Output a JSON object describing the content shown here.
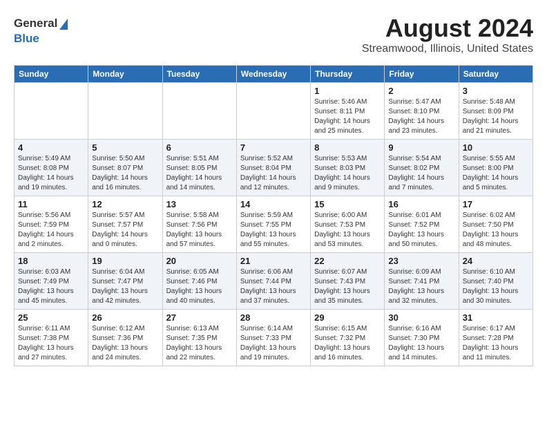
{
  "logo": {
    "general": "General",
    "blue": "Blue"
  },
  "header": {
    "title": "August 2024",
    "subtitle": "Streamwood, Illinois, United States"
  },
  "weekdays": [
    "Sunday",
    "Monday",
    "Tuesday",
    "Wednesday",
    "Thursday",
    "Friday",
    "Saturday"
  ],
  "weeks": [
    [
      {
        "day": "",
        "info": ""
      },
      {
        "day": "",
        "info": ""
      },
      {
        "day": "",
        "info": ""
      },
      {
        "day": "",
        "info": ""
      },
      {
        "day": "1",
        "info": "Sunrise: 5:46 AM\nSunset: 8:11 PM\nDaylight: 14 hours\nand 25 minutes."
      },
      {
        "day": "2",
        "info": "Sunrise: 5:47 AM\nSunset: 8:10 PM\nDaylight: 14 hours\nand 23 minutes."
      },
      {
        "day": "3",
        "info": "Sunrise: 5:48 AM\nSunset: 8:09 PM\nDaylight: 14 hours\nand 21 minutes."
      }
    ],
    [
      {
        "day": "4",
        "info": "Sunrise: 5:49 AM\nSunset: 8:08 PM\nDaylight: 14 hours\nand 19 minutes."
      },
      {
        "day": "5",
        "info": "Sunrise: 5:50 AM\nSunset: 8:07 PM\nDaylight: 14 hours\nand 16 minutes."
      },
      {
        "day": "6",
        "info": "Sunrise: 5:51 AM\nSunset: 8:05 PM\nDaylight: 14 hours\nand 14 minutes."
      },
      {
        "day": "7",
        "info": "Sunrise: 5:52 AM\nSunset: 8:04 PM\nDaylight: 14 hours\nand 12 minutes."
      },
      {
        "day": "8",
        "info": "Sunrise: 5:53 AM\nSunset: 8:03 PM\nDaylight: 14 hours\nand 9 minutes."
      },
      {
        "day": "9",
        "info": "Sunrise: 5:54 AM\nSunset: 8:02 PM\nDaylight: 14 hours\nand 7 minutes."
      },
      {
        "day": "10",
        "info": "Sunrise: 5:55 AM\nSunset: 8:00 PM\nDaylight: 14 hours\nand 5 minutes."
      }
    ],
    [
      {
        "day": "11",
        "info": "Sunrise: 5:56 AM\nSunset: 7:59 PM\nDaylight: 14 hours\nand 2 minutes."
      },
      {
        "day": "12",
        "info": "Sunrise: 5:57 AM\nSunset: 7:57 PM\nDaylight: 14 hours\nand 0 minutes."
      },
      {
        "day": "13",
        "info": "Sunrise: 5:58 AM\nSunset: 7:56 PM\nDaylight: 13 hours\nand 57 minutes."
      },
      {
        "day": "14",
        "info": "Sunrise: 5:59 AM\nSunset: 7:55 PM\nDaylight: 13 hours\nand 55 minutes."
      },
      {
        "day": "15",
        "info": "Sunrise: 6:00 AM\nSunset: 7:53 PM\nDaylight: 13 hours\nand 53 minutes."
      },
      {
        "day": "16",
        "info": "Sunrise: 6:01 AM\nSunset: 7:52 PM\nDaylight: 13 hours\nand 50 minutes."
      },
      {
        "day": "17",
        "info": "Sunrise: 6:02 AM\nSunset: 7:50 PM\nDaylight: 13 hours\nand 48 minutes."
      }
    ],
    [
      {
        "day": "18",
        "info": "Sunrise: 6:03 AM\nSunset: 7:49 PM\nDaylight: 13 hours\nand 45 minutes."
      },
      {
        "day": "19",
        "info": "Sunrise: 6:04 AM\nSunset: 7:47 PM\nDaylight: 13 hours\nand 42 minutes."
      },
      {
        "day": "20",
        "info": "Sunrise: 6:05 AM\nSunset: 7:46 PM\nDaylight: 13 hours\nand 40 minutes."
      },
      {
        "day": "21",
        "info": "Sunrise: 6:06 AM\nSunset: 7:44 PM\nDaylight: 13 hours\nand 37 minutes."
      },
      {
        "day": "22",
        "info": "Sunrise: 6:07 AM\nSunset: 7:43 PM\nDaylight: 13 hours\nand 35 minutes."
      },
      {
        "day": "23",
        "info": "Sunrise: 6:09 AM\nSunset: 7:41 PM\nDaylight: 13 hours\nand 32 minutes."
      },
      {
        "day": "24",
        "info": "Sunrise: 6:10 AM\nSunset: 7:40 PM\nDaylight: 13 hours\nand 30 minutes."
      }
    ],
    [
      {
        "day": "25",
        "info": "Sunrise: 6:11 AM\nSunset: 7:38 PM\nDaylight: 13 hours\nand 27 minutes."
      },
      {
        "day": "26",
        "info": "Sunrise: 6:12 AM\nSunset: 7:36 PM\nDaylight: 13 hours\nand 24 minutes."
      },
      {
        "day": "27",
        "info": "Sunrise: 6:13 AM\nSunset: 7:35 PM\nDaylight: 13 hours\nand 22 minutes."
      },
      {
        "day": "28",
        "info": "Sunrise: 6:14 AM\nSunset: 7:33 PM\nDaylight: 13 hours\nand 19 minutes."
      },
      {
        "day": "29",
        "info": "Sunrise: 6:15 AM\nSunset: 7:32 PM\nDaylight: 13 hours\nand 16 minutes."
      },
      {
        "day": "30",
        "info": "Sunrise: 6:16 AM\nSunset: 7:30 PM\nDaylight: 13 hours\nand 14 minutes."
      },
      {
        "day": "31",
        "info": "Sunrise: 6:17 AM\nSunset: 7:28 PM\nDaylight: 13 hours\nand 11 minutes."
      }
    ]
  ]
}
